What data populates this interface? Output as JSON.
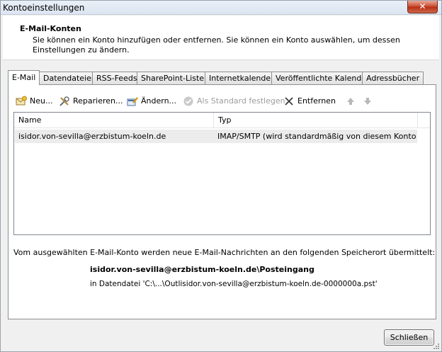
{
  "window": {
    "title": "Kontoeinstellungen",
    "close_glyph": "✕"
  },
  "header": {
    "title": "E-Mail-Konten",
    "description": "Sie können ein Konto hinzufügen oder entfernen. Sie können ein Konto auswählen, um dessen Einstellungen zu ändern."
  },
  "tabs": [
    {
      "label": "E-Mail",
      "active": true
    },
    {
      "label": "Datendateien"
    },
    {
      "label": "RSS-Feeds"
    },
    {
      "label": "SharePoint-Listen"
    },
    {
      "label": "Internetkalender"
    },
    {
      "label": "Veröffentlichte Kalender"
    },
    {
      "label": "Adressbücher"
    }
  ],
  "toolbar": {
    "new_label": "Neu...",
    "repair_label": "Reparieren...",
    "change_label": "Ändern...",
    "set_default_label": "Als Standard festlegen",
    "remove_label": "Entfernen",
    "move_up_icon": "arrow-up-icon",
    "move_down_icon": "arrow-down-icon"
  },
  "accounts_list": {
    "columns": [
      "Name",
      "Typ"
    ],
    "rows": [
      {
        "name": "isidor.von-sevilla@erzbistum-koeln.de",
        "type": "IMAP/SMTP (wird standardmäßig von diesem Konto ge..."
      }
    ]
  },
  "delivery": {
    "info": "Vom ausgewählten E-Mail-Konto werden neue E-Mail-Nachrichten an den folgenden Speicherort übermittelt:",
    "location": "isidor.von-sevilla@erzbistum-koeln.de\\Posteingang",
    "datafile": "in Datendatei 'C:\\...\\Outlisidor.von-sevilla@erzbistum-koeln.de-0000000a.pst'"
  },
  "footer": {
    "close_label": "Schließen"
  },
  "colors": {
    "window_bg": "#f0f0f0",
    "panel_bg": "#ffffff",
    "selected_row": "#ececec",
    "disabled_text": "#9c9c9c",
    "close_red": "#c7492e"
  }
}
